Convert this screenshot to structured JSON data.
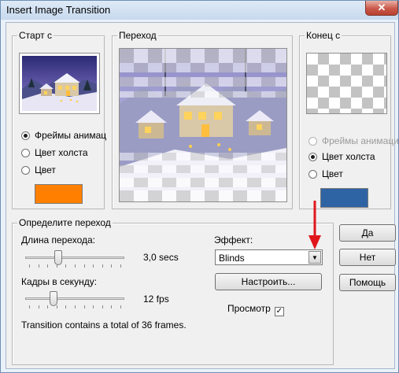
{
  "window": {
    "title": "Insert Image Transition",
    "close_glyph": "✕"
  },
  "start": {
    "group_label": "Старт с",
    "options": [
      {
        "label": "Фреймы анимац",
        "selected": true
      },
      {
        "label": "Цвет холста",
        "selected": false
      },
      {
        "label": "Цвет",
        "selected": false
      }
    ],
    "color": "#ff8000"
  },
  "transition_preview": {
    "group_label": "Переход"
  },
  "end": {
    "group_label": "Конец с",
    "options": [
      {
        "label": "Фреймы анимаци",
        "selected": false,
        "disabled": true
      },
      {
        "label": "Цвет холста",
        "selected": true
      },
      {
        "label": "Цвет",
        "selected": false
      }
    ],
    "color": "#2f64a4"
  },
  "define": {
    "group_label": "Определите переход",
    "length_label": "Длина перехода:",
    "length_value": "3,0 secs",
    "length_slider_fraction": 0.32,
    "fps_label": "Кадры в секунду:",
    "fps_value": "12 fps",
    "fps_slider_fraction": 0.27,
    "effect_label": "Эффект:",
    "effect_value": "Blinds",
    "configure_label": "Настроить...",
    "preview_label": "Просмотр",
    "preview_checked": true,
    "summary": "Transition contains a total of 36 frames."
  },
  "buttons": {
    "ok": "Да",
    "cancel": "Нет",
    "help": "Помощь"
  },
  "annotation": {
    "color": "#e0161c"
  }
}
